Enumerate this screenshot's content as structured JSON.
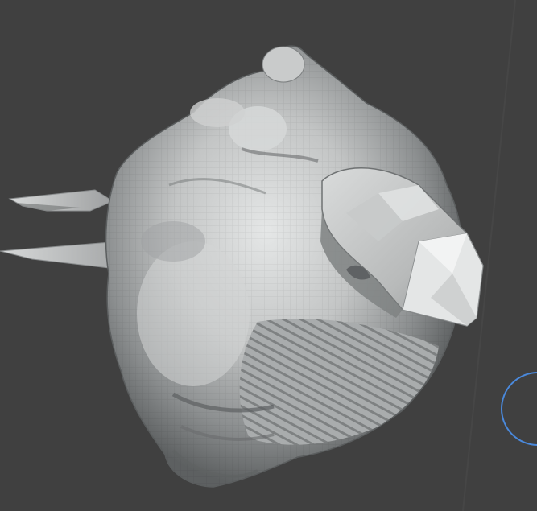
{
  "viewport": {
    "background_color": "#404040",
    "mesh_color": "#c4c6c6",
    "mesh_shadow_color": "#6d7071",
    "mesh_highlight_color": "#f0f1f1",
    "cursor_ring_color": "#4a89dc",
    "tool": "sculpt-brush-cursor"
  }
}
